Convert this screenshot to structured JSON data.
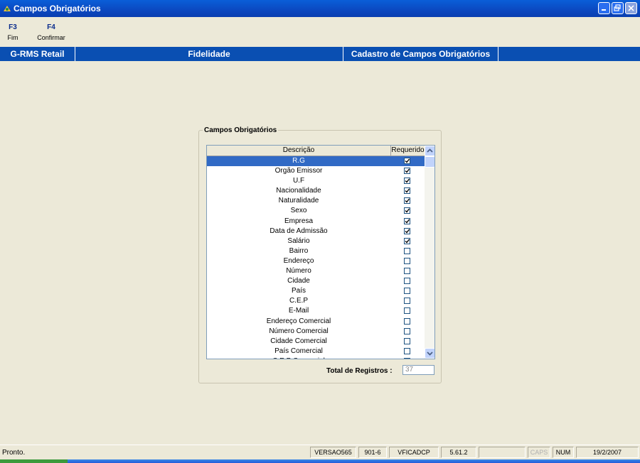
{
  "window": {
    "title": "Campos Obrigatórios",
    "icon": "app-icon"
  },
  "toolbar": {
    "items": [
      {
        "key": "F3",
        "label": "Fim"
      },
      {
        "key": "F4",
        "label": "Confirmar"
      }
    ]
  },
  "navbar": {
    "items": [
      {
        "label": "G-RMS Retail"
      },
      {
        "label": "Fidelidade"
      },
      {
        "label": "Cadastro de Campos Obrigatórios"
      }
    ]
  },
  "groupbox": {
    "title": "Campos Obrigatórios"
  },
  "grid": {
    "columns": [
      "Descrição",
      "Requerido"
    ],
    "rows": [
      {
        "desc": "R.G",
        "checked": true,
        "selected": true
      },
      {
        "desc": "Orgão Emissor",
        "checked": true
      },
      {
        "desc": "U.F",
        "checked": true
      },
      {
        "desc": "Nacionalidade",
        "checked": true
      },
      {
        "desc": "Naturalidade",
        "checked": true
      },
      {
        "desc": "Sexo",
        "checked": true
      },
      {
        "desc": "Empresa",
        "checked": true
      },
      {
        "desc": "Data de Admissão",
        "checked": true
      },
      {
        "desc": "Salário",
        "checked": true
      },
      {
        "desc": "Bairro",
        "checked": false
      },
      {
        "desc": "Endereço",
        "checked": false
      },
      {
        "desc": "Número",
        "checked": false
      },
      {
        "desc": "Cidade",
        "checked": false
      },
      {
        "desc": "País",
        "checked": false
      },
      {
        "desc": "C.E.P",
        "checked": false
      },
      {
        "desc": "E-Mail",
        "checked": false
      },
      {
        "desc": "Endereço Comercial",
        "checked": false
      },
      {
        "desc": "Número Comercial",
        "checked": false
      },
      {
        "desc": "Cidade Comercial",
        "checked": false
      },
      {
        "desc": "País Comercial",
        "checked": false
      },
      {
        "desc": "C.E.P Comercial",
        "checked": false
      }
    ]
  },
  "total": {
    "label": "Total de Registros :",
    "value": "37"
  },
  "status": {
    "left": "Pronto.",
    "panels": [
      {
        "text": "VERSAO565"
      },
      {
        "text": "901-6"
      },
      {
        "text": "VFICADCP"
      },
      {
        "text": "5.61.2"
      },
      {
        "text": ""
      },
      {
        "text": "CAPS",
        "dim": true
      },
      {
        "text": "NUM"
      },
      {
        "text": "19/2/2007"
      }
    ]
  },
  "colors": {
    "titlebar": "#0a5fd8",
    "navbar": "#0a4fb2",
    "selection": "#316ac5",
    "background": "#ece9d8"
  }
}
